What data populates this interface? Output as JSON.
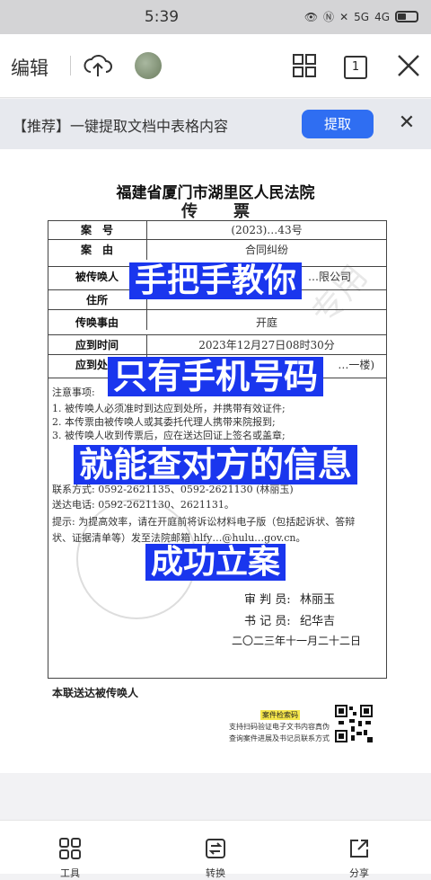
{
  "status_bar": {
    "time": "5:39",
    "net1": "5G",
    "net2": "4G"
  },
  "toolbar": {
    "edit_label": "编辑",
    "page_count": "1"
  },
  "banner": {
    "text": "【推荐】一键提取文档中表格内容",
    "button": "提取"
  },
  "document": {
    "court_name": "福建省厦门市湖里区人民法院",
    "doc_type": "传票",
    "table": [
      {
        "label": "案　号",
        "value": "(2023)…43号"
      },
      {
        "label": "案　由",
        "value": "合同纠纷"
      },
      {
        "label": "被传唤人",
        "value": "…限公司"
      },
      {
        "label": "住所",
        "value": ""
      },
      {
        "label": "传唤事由",
        "value": "开庭"
      },
      {
        "label": "应到时间",
        "value": "2023年12月27日08时30分"
      },
      {
        "label": "应到处所",
        "value": "…一楼)"
      }
    ],
    "notes": [
      "注意事项:",
      "1. 被传唤人必须准时到达应到处所，并携带有效证件;",
      "2. 本传票由被传唤人或其委托代理人携带来院报到;",
      "3. 被传唤人收到传票后，应在送达回证上签名或盖章;",
      "联系方式: 0592-2621135、0592-2621130 (林丽玉)",
      "送达电话: 0592-2621130、2621131。",
      "提示: 为提高效率，请在开庭前将诉讼材料电子版（包括起诉状、答辩",
      "状、证据清单等）发至法院邮箱 hlfy…@hulu…gov.cn。"
    ],
    "judge_label": "审 判 员:",
    "judge_name": "林丽玉",
    "clerk_label": "书 记 员:",
    "clerk_name": "纪华吉",
    "date": "二〇二三年十一月二十二日",
    "footer": "本联送达被传唤人",
    "qr_tag": "案件检索码",
    "qr_line1": "支持扫码验证电子文书内容真伪",
    "qr_line2": "查询案件进展及书记员联系方式"
  },
  "overlay_lines": [
    "手把手教你",
    "只有手机号码",
    "就能查对方的信息",
    "成功立案"
  ],
  "bottom_bar": {
    "items": [
      "工具",
      "转换",
      "分享"
    ]
  },
  "colors": {
    "accent": "#2f6ef2",
    "overlay": "#1a36ee"
  }
}
